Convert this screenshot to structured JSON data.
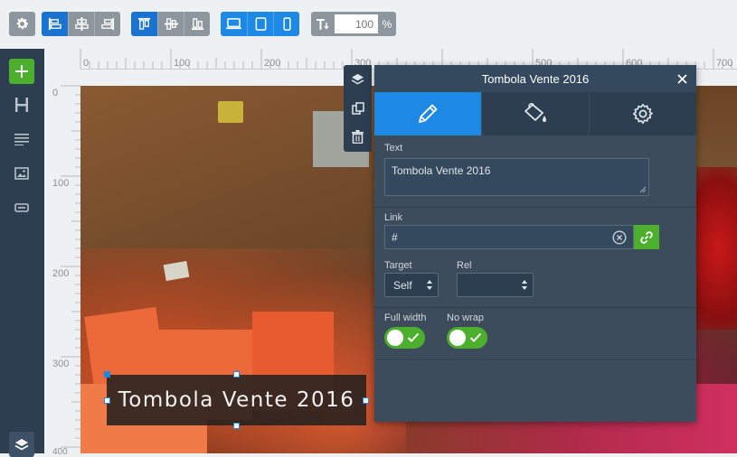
{
  "toolbar": {
    "opacity_value": "100",
    "opacity_unit": "%",
    "groups": {
      "align": [
        "align-left-icon",
        "align-center-icon",
        "align-right-icon"
      ],
      "valign": [
        "align-top-icon",
        "align-middle-icon",
        "align-bottom-icon"
      ],
      "devices": [
        "desktop-icon",
        "tablet-icon",
        "mobile-icon"
      ]
    }
  },
  "sidebar": {
    "items": [
      "add-icon",
      "heading-icon",
      "text-icon",
      "image-icon",
      "button-icon",
      "layers-icon"
    ]
  },
  "rulers": {
    "horizontal": [
      "0",
      "100",
      "200",
      "300",
      "400",
      "500",
      "600",
      "700"
    ],
    "vertical": [
      "0",
      "100",
      "200",
      "300",
      "400"
    ]
  },
  "canvas": {
    "caption_text": "Tombola Vente 2016"
  },
  "panel": {
    "title": "Tombola Vente 2016",
    "tabs": [
      {
        "icon": "pencil-icon",
        "active": true
      },
      {
        "icon": "paint-bucket-icon",
        "active": false
      },
      {
        "icon": "gear-icon",
        "active": false
      }
    ],
    "text_label": "Text",
    "text_value": "Tombola Vente 2016",
    "link_label": "Link",
    "link_value": "#",
    "target_label": "Target",
    "target_value": "Self",
    "rel_label": "Rel",
    "rel_value": "",
    "full_width_label": "Full width",
    "full_width_on": true,
    "no_wrap_label": "No wrap",
    "no_wrap_on": true
  },
  "colors": {
    "accent_blue": "#1e88e5",
    "accent_green": "#4caf2d",
    "panel_bg": "#3d4c5b",
    "sidebar_bg": "#2c3e50"
  }
}
